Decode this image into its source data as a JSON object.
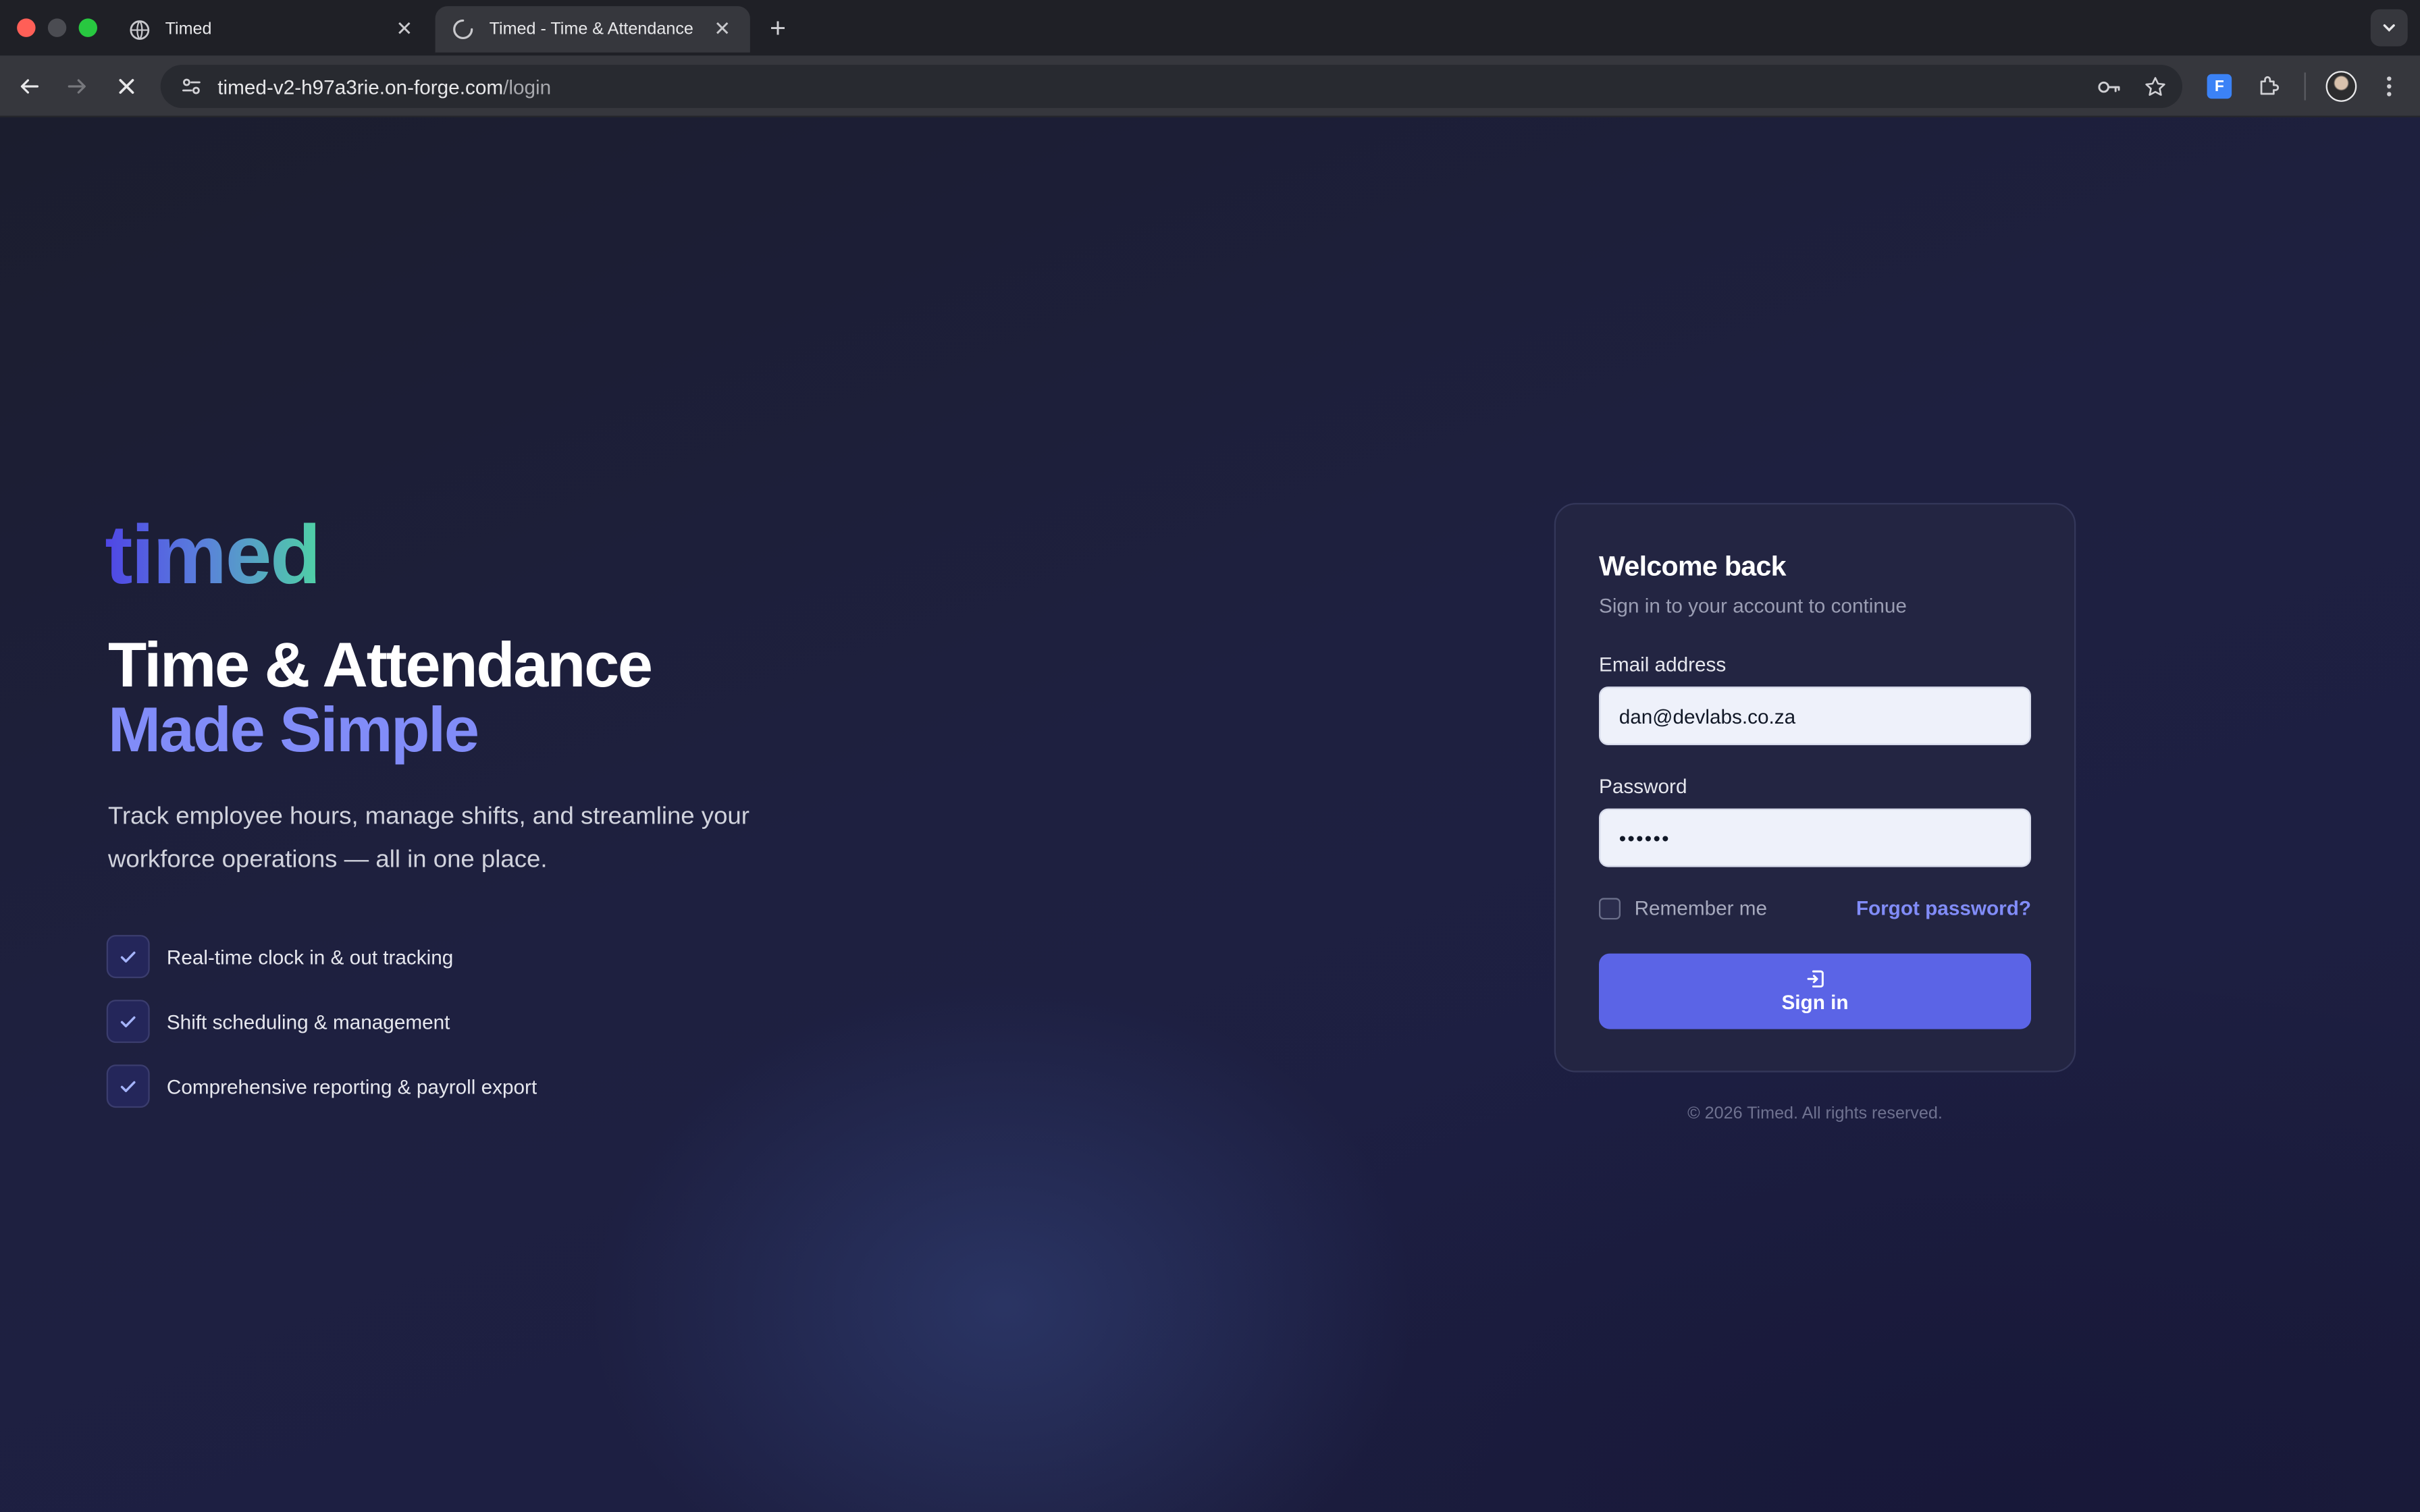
{
  "browser": {
    "tabs": [
      {
        "title": "Timed",
        "favicon": "globe-icon"
      },
      {
        "title": "Timed - Time & Attendance",
        "favicon": "loading-spinner-icon"
      }
    ],
    "url_host": "timed-v2-h97a3rie.on-forge.com",
    "url_path": "/login",
    "extension_label": "F"
  },
  "hero": {
    "logo": "timed",
    "headline_line1": "Time & Attendance",
    "headline_line2": "Made Simple",
    "description": "Track employee hours, manage shifts, and streamline your workforce operations — all in one place.",
    "features": [
      "Real-time clock in & out tracking",
      "Shift scheduling & management",
      "Comprehensive reporting & payroll export"
    ]
  },
  "login": {
    "title": "Welcome back",
    "subtitle": "Sign in to your account to continue",
    "email_label": "Email address",
    "email_value": "dan@devlabs.co.za",
    "password_label": "Password",
    "password_value": "••••••",
    "remember_label": "Remember me",
    "forgot_label": "Forgot password?",
    "submit_label": "Sign in"
  },
  "footer": {
    "copyright": "© 2026 Timed. All rights reserved."
  },
  "colors": {
    "accent": "#5b64e6",
    "accent_text": "#818cf8",
    "logo_gradient_start": "#4f46e5",
    "logo_gradient_end": "#4fd1a5"
  }
}
